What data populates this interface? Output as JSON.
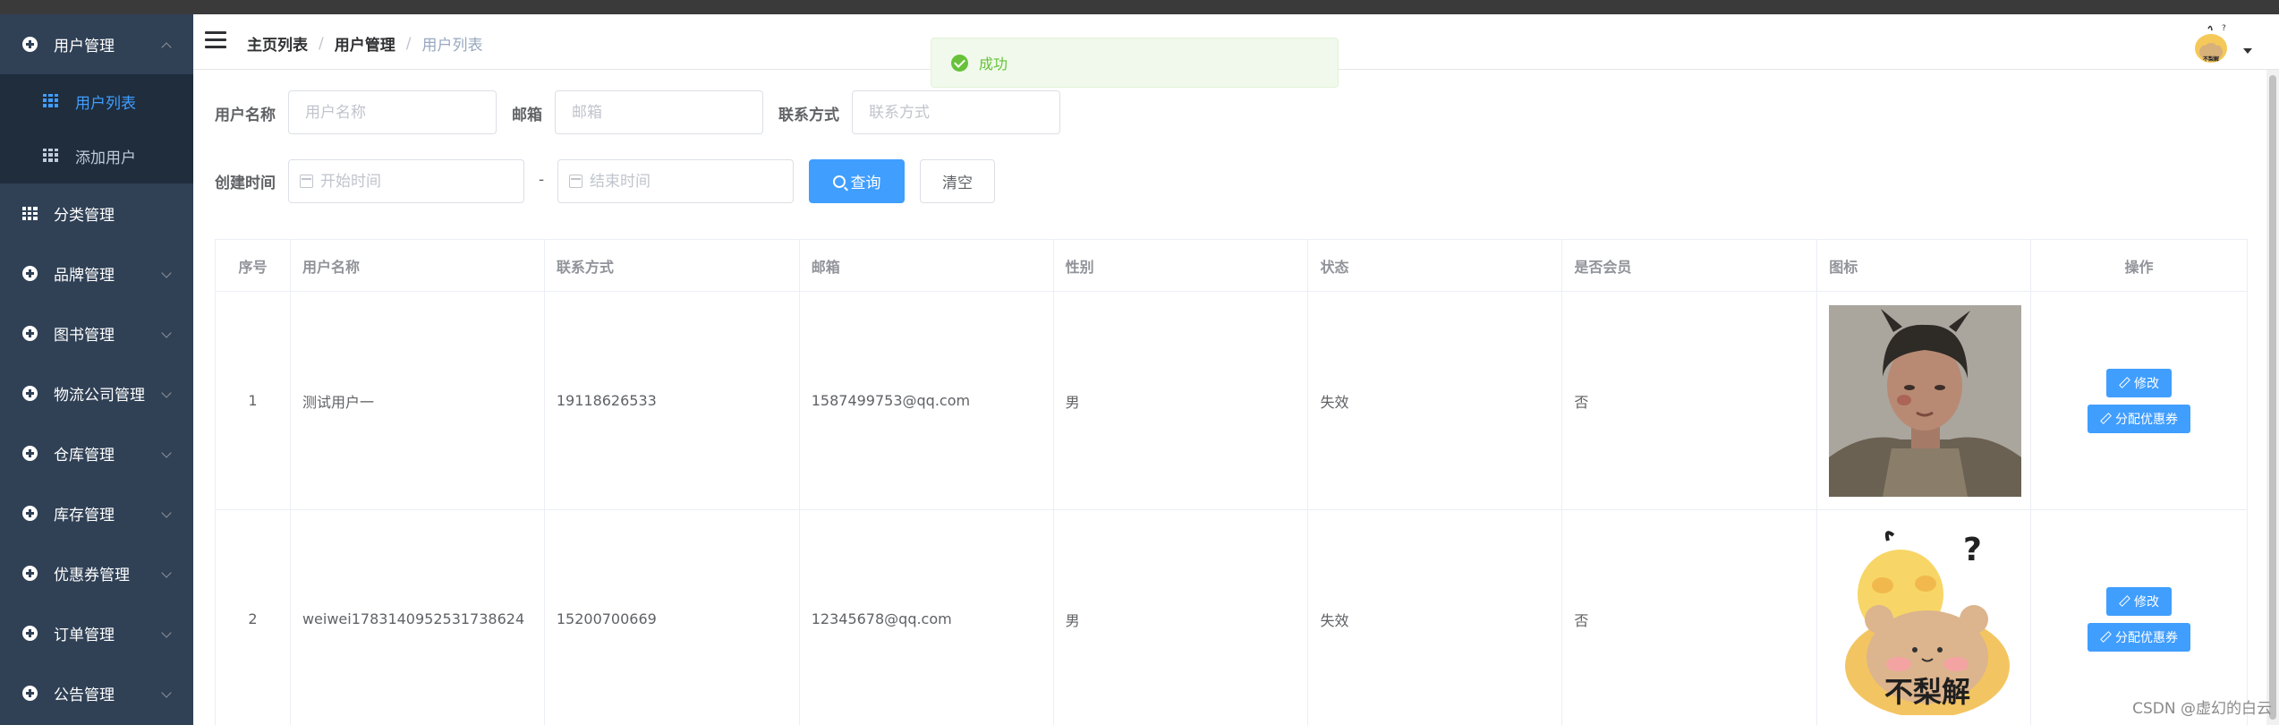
{
  "sidebar": {
    "items": [
      {
        "label": "用户管理",
        "expanded": true,
        "children": [
          {
            "label": "用户列表",
            "active": true
          },
          {
            "label": "添加用户",
            "active": false
          }
        ]
      },
      {
        "label": "分类管理"
      },
      {
        "label": "品牌管理"
      },
      {
        "label": "图书管理"
      },
      {
        "label": "物流公司管理"
      },
      {
        "label": "仓库管理"
      },
      {
        "label": "库存管理"
      },
      {
        "label": "优惠券管理"
      },
      {
        "label": "订单管理"
      },
      {
        "label": "公告管理"
      }
    ]
  },
  "breadcrumb": [
    "主页列表",
    "用户管理",
    "用户列表"
  ],
  "message": {
    "text": "成功",
    "type": "success"
  },
  "search": {
    "username_label": "用户名称",
    "username_placeholder": "用户名称",
    "email_label": "邮箱",
    "email_placeholder": "邮箱",
    "contact_label": "联系方式",
    "contact_placeholder": "联系方式",
    "created_label": "创建时间",
    "start_placeholder": "开始时间",
    "range_separator": "-",
    "end_placeholder": "结束时间",
    "query_button": "查询",
    "clear_button": "清空"
  },
  "table": {
    "headers": [
      "序号",
      "用户名称",
      "联系方式",
      "邮箱",
      "性别",
      "状态",
      "是否会员",
      "图标",
      "操作"
    ],
    "rows": [
      {
        "index": "1",
        "username": "测试用户一",
        "contact": "19118626533",
        "email": "1587499753@qq.com",
        "gender": "男",
        "status": "失效",
        "member": "否",
        "icon": "portrait-photo"
      },
      {
        "index": "2",
        "username": "weiwei1783140952531738624",
        "contact": "15200700669",
        "email": "12345678@qq.com",
        "gender": "男",
        "status": "失效",
        "member": "否",
        "icon": "cartoon-chick-bear"
      }
    ],
    "edit_label": "修改",
    "coupon_label": "分配优惠券"
  },
  "avatar_caption": "不梨解",
  "watermark": "CSDN @虚幻的白云",
  "colors": {
    "sidebar_bg": "#304156",
    "submenu_bg": "#1f2d3d",
    "primary": "#409eff",
    "success": "#67c23a"
  }
}
